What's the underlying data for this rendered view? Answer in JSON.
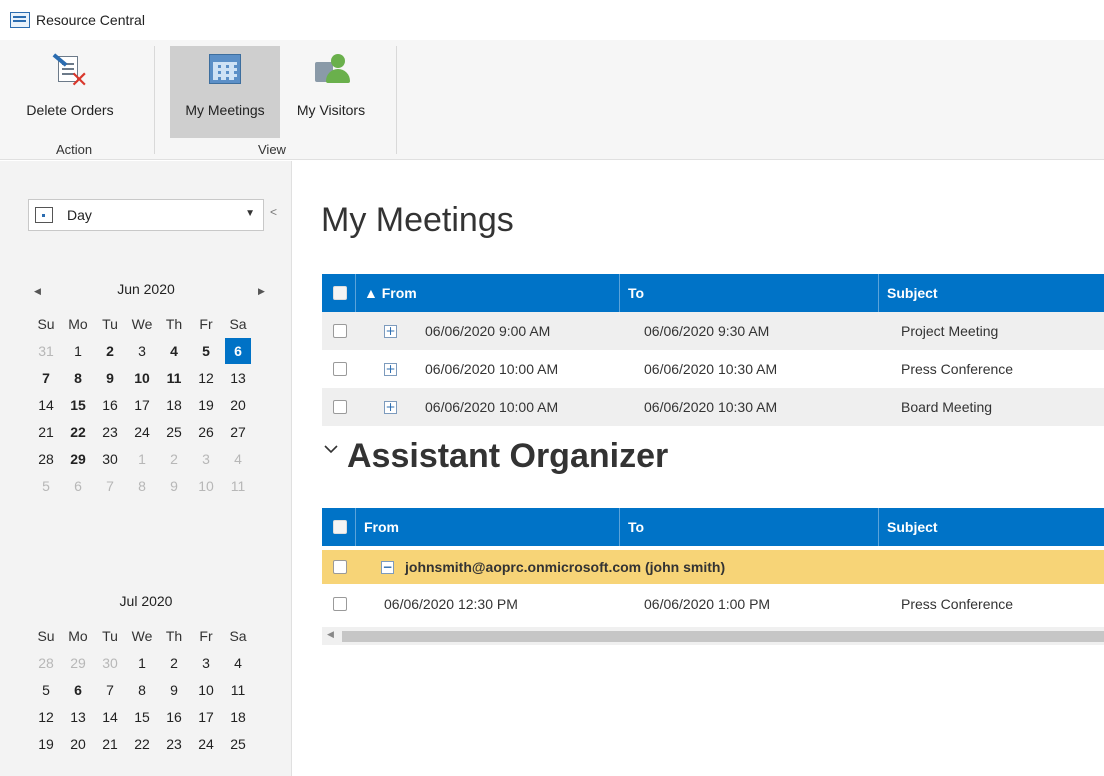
{
  "app": {
    "title": "Resource Central"
  },
  "ribbon": {
    "delete_orders": "Delete Orders",
    "my_meetings": "My Meetings",
    "my_visitors": "My Visitors",
    "group_action": "Action",
    "group_view": "View"
  },
  "sidebar": {
    "view_mode": "Day",
    "months": [
      {
        "title": "Jun 2020",
        "weekdays": [
          "Su",
          "Mo",
          "Tu",
          "We",
          "Th",
          "Fr",
          "Sa"
        ],
        "days": [
          [
            "31",
            "1",
            "2",
            "3",
            "4",
            "5",
            "6"
          ],
          [
            "7",
            "8",
            "9",
            "10",
            "11",
            "12",
            "13"
          ],
          [
            "14",
            "15",
            "16",
            "17",
            "18",
            "19",
            "20"
          ],
          [
            "21",
            "22",
            "23",
            "24",
            "25",
            "26",
            "27"
          ],
          [
            "28",
            "29",
            "30",
            "1",
            "2",
            "3",
            "4"
          ],
          [
            "5",
            "6",
            "7",
            "8",
            "9",
            "10",
            "11"
          ]
        ]
      },
      {
        "title": "Jul 2020",
        "weekdays": [
          "Su",
          "Mo",
          "Tu",
          "We",
          "Th",
          "Fr",
          "Sa"
        ],
        "days": [
          [
            "28",
            "29",
            "30",
            "1",
            "2",
            "3",
            "4"
          ],
          [
            "5",
            "6",
            "7",
            "8",
            "9",
            "10",
            "11"
          ],
          [
            "12",
            "13",
            "14",
            "15",
            "16",
            "17",
            "18"
          ],
          [
            "19",
            "20",
            "21",
            "22",
            "23",
            "24",
            "25"
          ]
        ]
      }
    ]
  },
  "main": {
    "title": "My Meetings",
    "meetings": {
      "columns": {
        "from": "From",
        "to": "To",
        "subject": "Subject"
      },
      "rows": [
        {
          "from": "06/06/2020 9:00 AM",
          "to": "06/06/2020 9:30 AM",
          "subject": "Project Meeting"
        },
        {
          "from": "06/06/2020 10:00 AM",
          "to": "06/06/2020 10:30 AM",
          "subject": "Press Conference"
        },
        {
          "from": "06/06/2020 10:00 AM",
          "to": "06/06/2020 10:30 AM",
          "subject": "Board Meeting"
        }
      ]
    },
    "section_title": "Assistant Organizer",
    "assistant": {
      "columns": {
        "from": "From",
        "to": "To",
        "subject": "Subject"
      },
      "group": "johnsmith@aoprc.onmicrosoft.com (john smith)",
      "rows": [
        {
          "from": "06/06/2020 12:30 PM",
          "to": "06/06/2020 1:00 PM",
          "subject": "Press Conference"
        }
      ]
    }
  }
}
